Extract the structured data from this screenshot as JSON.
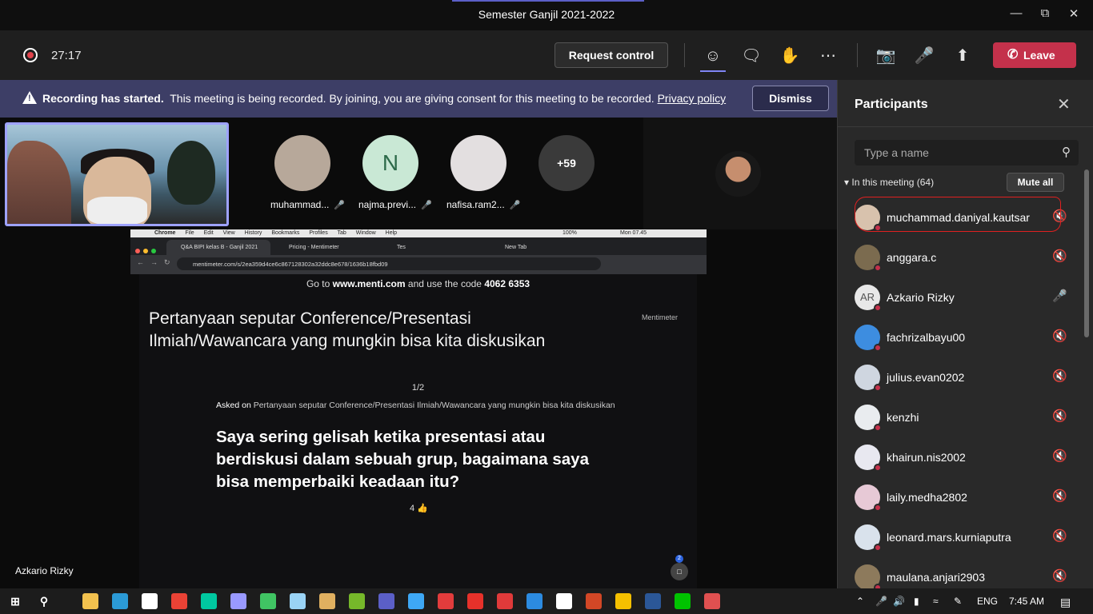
{
  "window": {
    "title": "Semester Ganjil 2021-2022",
    "controls": [
      "minimize",
      "maximize",
      "close"
    ]
  },
  "topbar": {
    "timer": "27:17",
    "request_control": "Request control",
    "leave": "Leave",
    "icons": [
      "people-icon",
      "chat-icon",
      "reactions-icon",
      "more-icon",
      "camera-off-icon",
      "mic-off-icon",
      "share-icon"
    ]
  },
  "banner": {
    "bold": "Recording has started.",
    "text": "This meeting is being recorded. By joining, you are giving consent for this meeting to be recorded.",
    "link": "Privacy policy",
    "dismiss": "Dismiss"
  },
  "stage": {
    "participants": [
      {
        "name": "muhammad...",
        "color": "#b7a89a"
      },
      {
        "name": "najma.previ...",
        "initial": "N",
        "color": "#c9e8d5"
      },
      {
        "name": "nafisa.ram2...",
        "color": "#e3dfe0"
      }
    ],
    "more_count": "+59",
    "speaker_name": "Azkario Rizky"
  },
  "browser": {
    "menu": [
      "Chrome",
      "File",
      "Edit",
      "View",
      "History",
      "Bookmarks",
      "Profiles",
      "Tab",
      "Window",
      "Help"
    ],
    "status": "100%",
    "clock": "Mon 07.45",
    "tabs": [
      "Q&A BIPI kelas B - Ganjil 2021",
      "Pricing - Mentimeter",
      "Tes",
      "New Tab"
    ],
    "url": "mentimeter.com/s/2ea359d4ce6c867128302a32ddc8e678/1636b18fbd09"
  },
  "menti": {
    "goto_prefix": "Go to",
    "goto_site": "www.menti.com",
    "goto_mid": "and use the code",
    "goto_code": "4062 6353",
    "title": "Pertanyaan seputar Conference/Presentasi Ilmiah/Wawancara yang mungkin bisa kita diskusikan",
    "brand": "Mentimeter",
    "pager": "1/2",
    "asked_label": "Asked on",
    "asked_text": "Pertanyaan seputar Conference/Presentasi Ilmiah/Wawancara yang mungkin bisa kita diskusikan",
    "question": "Saya sering gelisah ketika presentasi atau berdiskusi dalam sebuah grup, bagaimana saya bisa memperbaiki keadaan itu?",
    "votes": "4",
    "chat_badge": "2"
  },
  "panel": {
    "title": "Participants",
    "search_placeholder": "Type a name",
    "in_meeting": "In this meeting (64)",
    "mute_all": "Mute all",
    "people": [
      {
        "name": "muchammad.daniyal.kautsar",
        "color": "#d8c2ad",
        "mic": "muted"
      },
      {
        "name": "anggara.c",
        "color": "#7b6b4f",
        "mic": "muted"
      },
      {
        "name": "Azkario Rizky",
        "initials": "AR",
        "color": "#e8e8e8",
        "mic": "on"
      },
      {
        "name": "fachrizalbayu00",
        "color": "#3d8de0",
        "mic": "muted"
      },
      {
        "name": "julius.evan0202",
        "color": "#cfd6e0",
        "mic": "muted"
      },
      {
        "name": "kenzhi",
        "color": "#e9ecef",
        "mic": "muted"
      },
      {
        "name": "khairun.nis2002",
        "color": "#e8e8f0",
        "mic": "muted"
      },
      {
        "name": "laily.medha2802",
        "color": "#e7c9d6",
        "mic": "muted"
      },
      {
        "name": "leonard.mars.kurniaputra",
        "color": "#d9e2ec",
        "mic": "muted"
      },
      {
        "name": "maulana.anjari2903",
        "color": "#8d7a5c",
        "mic": "muted"
      }
    ]
  },
  "taskbar": {
    "apps": [
      "file-explorer",
      "edge",
      "store",
      "chrome",
      "audition",
      "premiere",
      "maps",
      "notepad",
      "files",
      "utorrent",
      "teams",
      "cloud",
      "app-red",
      "acrobat",
      "power",
      "ie",
      "settings",
      "powerpoint",
      "star",
      "word",
      "line",
      "photos"
    ],
    "lang": "ENG",
    "time": "7:45 AM"
  }
}
